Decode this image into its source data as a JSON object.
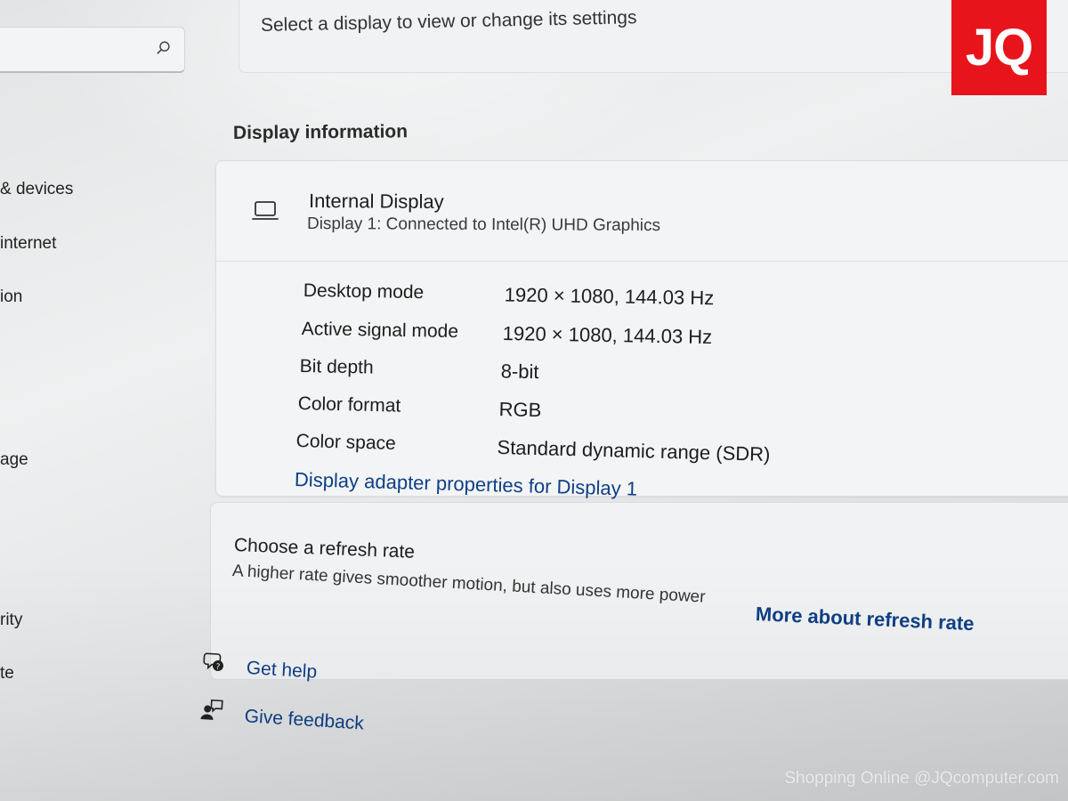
{
  "sidebar": {
    "search_placeholder": "",
    "items": [
      {
        "label": "& devices"
      },
      {
        "label": "internet"
      },
      {
        "label": "ion"
      },
      {
        "label": "age"
      },
      {
        "label": "rity"
      },
      {
        "label": "te"
      }
    ]
  },
  "main": {
    "select_display_text": "Select a display to view or change its settings",
    "section_title": "Display information",
    "display": {
      "name": "Internal Display",
      "subtitle": "Display 1: Connected to Intel(R) UHD Graphics",
      "icon": "monitor-icon"
    },
    "properties": [
      {
        "label": "Desktop mode",
        "value": "1920 × 1080, 144.03 Hz"
      },
      {
        "label": "Active signal mode",
        "value": "1920 × 1080, 144.03 Hz"
      },
      {
        "label": "Bit depth",
        "value": "8-bit"
      },
      {
        "label": "Color format",
        "value": "RGB"
      },
      {
        "label": "Color space",
        "value": "Standard dynamic range (SDR)"
      }
    ],
    "adapter_link": "Display adapter properties for Display 1",
    "refresh": {
      "title": "Choose a refresh rate",
      "description": "A higher rate gives smoother motion, but also uses more power",
      "link": "More about refresh rate"
    },
    "help": {
      "get_help": "Get help",
      "give_feedback": "Give feedback"
    }
  },
  "branding": {
    "logo_text": "JQ",
    "logo_color": "#e8141b",
    "watermark": "Shopping Online @JQcomputer.com"
  },
  "colors": {
    "link": "#0f3f86",
    "card_bg": "#f3f4f5"
  }
}
